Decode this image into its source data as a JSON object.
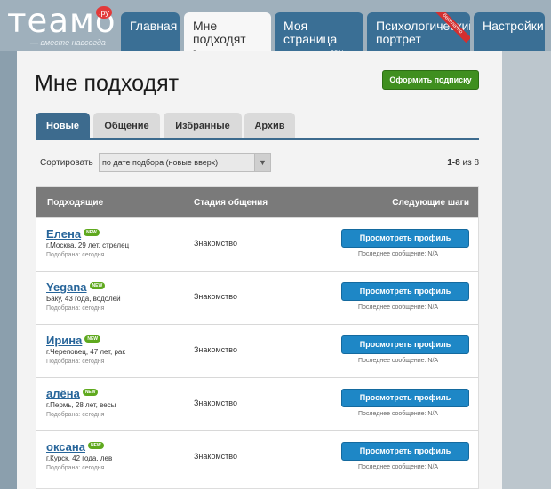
{
  "logo": {
    "text": "теамо",
    "ru": ".ру",
    "tagline": "— вместе навсегда"
  },
  "nav": [
    {
      "title": "Главная",
      "sub": ""
    },
    {
      "title": "Мне подходят",
      "sub": "8 новых подходящих"
    },
    {
      "title": "Моя страница",
      "sub": "заполнена на 60%"
    },
    {
      "title": "Психологический портрет",
      "sub": "",
      "ribbon": "бесплатно"
    },
    {
      "title": "Настройки",
      "sub": ""
    }
  ],
  "page": {
    "title": "Мне подходят",
    "subscribe": "Оформить подписку"
  },
  "tabs": [
    "Новые",
    "Общение",
    "Избранные",
    "Архив"
  ],
  "sort": {
    "label": "Сортировать",
    "value": "по дате подбора (новые вверх)"
  },
  "pager": {
    "range": "1-8",
    "of": "из",
    "total": "8"
  },
  "table": {
    "headers": [
      "Подходящие",
      "Стадия общения",
      "Следующие шаги"
    ],
    "rows": [
      {
        "name": "Елена",
        "new": "NEW",
        "info": "г.Москва, 29 лет, стрелец",
        "picked": "Подобрана: сегодня",
        "stage": "Знакомство",
        "btn": "Просмотреть профиль",
        "last": "Последнее сообщение: N/A"
      },
      {
        "name": "Yegana",
        "new": "NEW",
        "info": "Баку, 43 года, водолей",
        "picked": "Подобрана: сегодня",
        "stage": "Знакомство",
        "btn": "Просмотреть профиль",
        "last": "Последнее сообщение: N/A"
      },
      {
        "name": "Ирина",
        "new": "NEW",
        "info": "г.Череповец, 47 лет, рак",
        "picked": "Подобрана: сегодня",
        "stage": "Знакомство",
        "btn": "Просмотреть профиль",
        "last": "Последнее сообщение: N/A"
      },
      {
        "name": "алёна",
        "new": "NEW",
        "info": "г.Пермь, 28 лет, весы",
        "picked": "Подобрана: сегодня",
        "stage": "Знакомство",
        "btn": "Просмотреть профиль",
        "last": "Последнее сообщение: N/A"
      },
      {
        "name": "оксана",
        "new": "NEW",
        "info": "г.Курск, 42 года, лев",
        "picked": "Подобрана: сегодня",
        "stage": "Знакомство",
        "btn": "Просмотреть профиль",
        "last": "Последнее сообщение: N/A"
      }
    ]
  },
  "colors": {
    "brand": "#3a6f95",
    "subscribe": "#3f8f1f",
    "button": "#1e87c6",
    "link": "#27659a"
  }
}
